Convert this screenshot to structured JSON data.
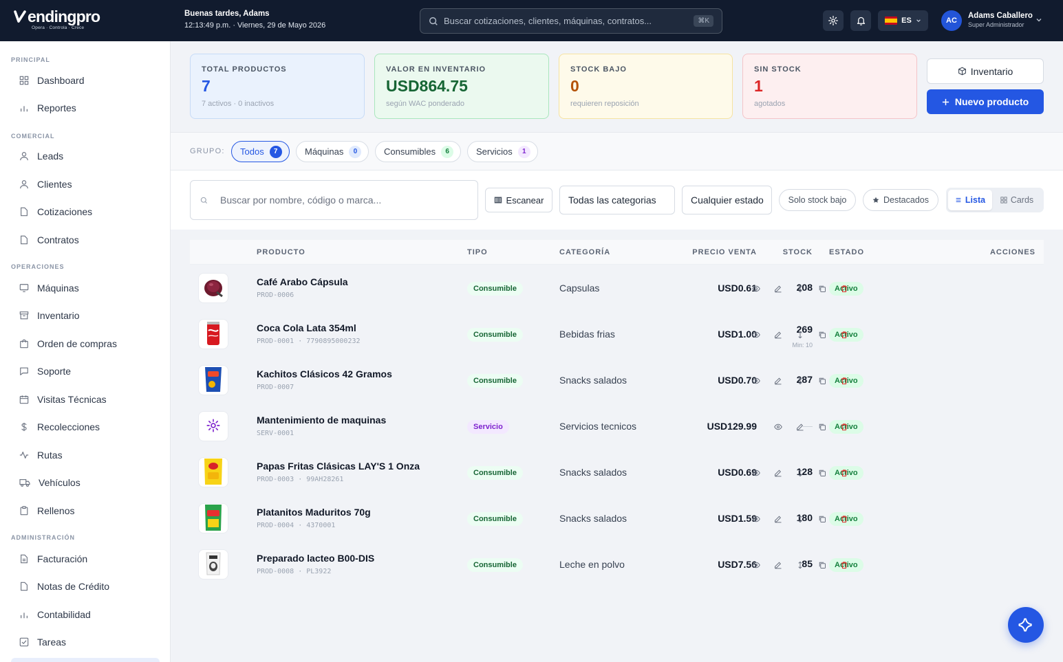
{
  "brand": {
    "logo": "endingpro",
    "tagline": "Opera · Controla · Crece"
  },
  "header": {
    "greeting": "Buenas tardes, Adams",
    "datetime": "12:13:49 p.m. · Viernes, 29 de Mayo 2026",
    "search_placeholder": "Buscar cotizaciones, clientes, máquinas, contratos...",
    "search_shortcut": "⌘K",
    "language": "ES",
    "user_initials": "AC",
    "user_name": "Adams Caballero",
    "user_role": "Super Administrador"
  },
  "sidebar": {
    "principal": "PRINCIPAL",
    "comercial": "COMERCIAL",
    "operaciones": "OPERACIONES",
    "administracion": "ADMINISTRACIÓN",
    "items": [
      "Dashboard",
      "Reportes",
      "Leads",
      "Clientes",
      "Cotizaciones",
      "Contratos",
      "Máquinas",
      "Inventario",
      "Orden de compras",
      "Soporte",
      "Visitas Técnicas",
      "Recolecciones",
      "Rutas",
      "Vehículos",
      "Rellenos",
      "Facturación",
      "Notas de Crédito",
      "Contabilidad",
      "Tareas"
    ]
  },
  "stats": [
    {
      "label": "TOTAL PRODUCTOS",
      "value": "7",
      "sub": "7 activos · 0 inactivos"
    },
    {
      "label": "VALOR EN INVENTARIO",
      "value": "USD864.75",
      "sub": "según WAC ponderado"
    },
    {
      "label": "STOCK BAJO",
      "value": "0",
      "sub": "requieren reposición"
    },
    {
      "label": "SIN STOCK",
      "value": "1",
      "sub": "agotados"
    }
  ],
  "actions": {
    "inventario": "Inventario",
    "nuevo": "Nuevo producto"
  },
  "groups": {
    "label": "GRUPO:",
    "items": [
      {
        "label": "Todos",
        "count": "7"
      },
      {
        "label": "Máquinas",
        "count": "0"
      },
      {
        "label": "Consumibles",
        "count": "6"
      },
      {
        "label": "Servicios",
        "count": "1"
      }
    ]
  },
  "filters": {
    "search_placeholder": "Buscar por nombre, código o marca...",
    "scan": "Escanear",
    "category": "Todas las categorias",
    "status": "Cualquier estado",
    "low_stock": "Solo stock bajo",
    "featured": "Destacados",
    "view_list": "Lista",
    "view_cards": "Cards"
  },
  "table": {
    "headers": [
      "PRODUCTO",
      "TIPO",
      "CATEGORÍA",
      "PRECIO VENTA",
      "STOCK",
      "ESTADO",
      "ACCIONES"
    ],
    "rows": [
      {
        "name": "Café Arabo Cápsula",
        "code": "PROD-0006",
        "tipo": "Consumible",
        "cat": "Capsulas",
        "price": "USD0.61",
        "stock": "208",
        "min": "",
        "estado": "Activo",
        "thumb": "capsule"
      },
      {
        "name": "Coca Cola Lata 354ml",
        "code": "PROD-0001  ·  7790895000232",
        "tipo": "Consumible",
        "cat": "Bebidas frias",
        "price": "USD1.00",
        "stock": "269",
        "min": "Min: 10",
        "estado": "Activo",
        "thumb": "can"
      },
      {
        "name": "Kachitos Clásicos 42 Gramos",
        "code": "PROD-0007",
        "tipo": "Consumible",
        "cat": "Snacks salados",
        "price": "USD0.70",
        "stock": "287",
        "min": "",
        "estado": "Activo",
        "thumb": "bag-blue"
      },
      {
        "name": "Mantenimiento de maquinas",
        "code": "SERV-0001",
        "tipo": "Servicio",
        "cat": "Servicios tecnicos",
        "price": "USD129.99",
        "stock": "—",
        "min": "",
        "estado": "Activo",
        "thumb": "gear"
      },
      {
        "name": "Papas Fritas Clásicas LAY'S 1 Onza",
        "code": "PROD-0003  ·  99AH28261",
        "tipo": "Consumible",
        "cat": "Snacks salados",
        "price": "USD0.69",
        "stock": "128",
        "min": "",
        "estado": "Activo",
        "thumb": "bag-yellow"
      },
      {
        "name": "Platanitos Maduritos 70g",
        "code": "PROD-0004  ·  4370001",
        "tipo": "Consumible",
        "cat": "Snacks salados",
        "price": "USD1.59",
        "stock": "180",
        "min": "",
        "estado": "Activo",
        "thumb": "bag-green"
      },
      {
        "name": "Preparado lacteo B00-DIS",
        "code": "PROD-0008  ·  PL3922",
        "tipo": "Consumible",
        "cat": "Leche en polvo",
        "price": "USD7.56",
        "stock": "85",
        "min": "",
        "estado": "Activo",
        "thumb": "bag-white"
      }
    ]
  },
  "colors": {
    "accent": "#2457e3",
    "header_bg": "#111b2e",
    "active_green": "#15803d",
    "danger": "#dc2626"
  }
}
